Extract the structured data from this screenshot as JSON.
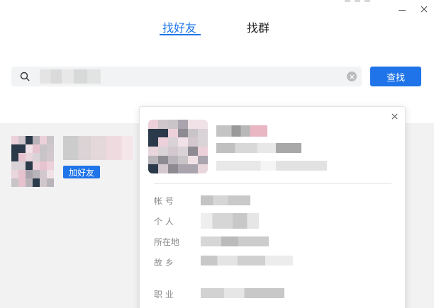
{
  "window": {
    "minimize_icon": "minimize-icon",
    "close_icon": "close-icon"
  },
  "tabs": [
    {
      "label": "找好友",
      "active": true
    },
    {
      "label": "找群",
      "active": false
    }
  ],
  "search": {
    "value": "",
    "placeholder": "",
    "button_label": "查找",
    "search_icon": "search-icon",
    "clear_icon": "clear-icon"
  },
  "result": {
    "add_button_label": "加好友"
  },
  "profile_card": {
    "close_icon": "close-icon",
    "fields": {
      "account_label": "帐 号",
      "personal_label": "个 人",
      "location_label": "所在地",
      "hometown_label": "故 乡",
      "occupation_label": "职 业"
    }
  },
  "colors": {
    "accent": "#1e74e8",
    "results_bg": "#f2f2f3",
    "search_bg": "#f1f3f5"
  }
}
